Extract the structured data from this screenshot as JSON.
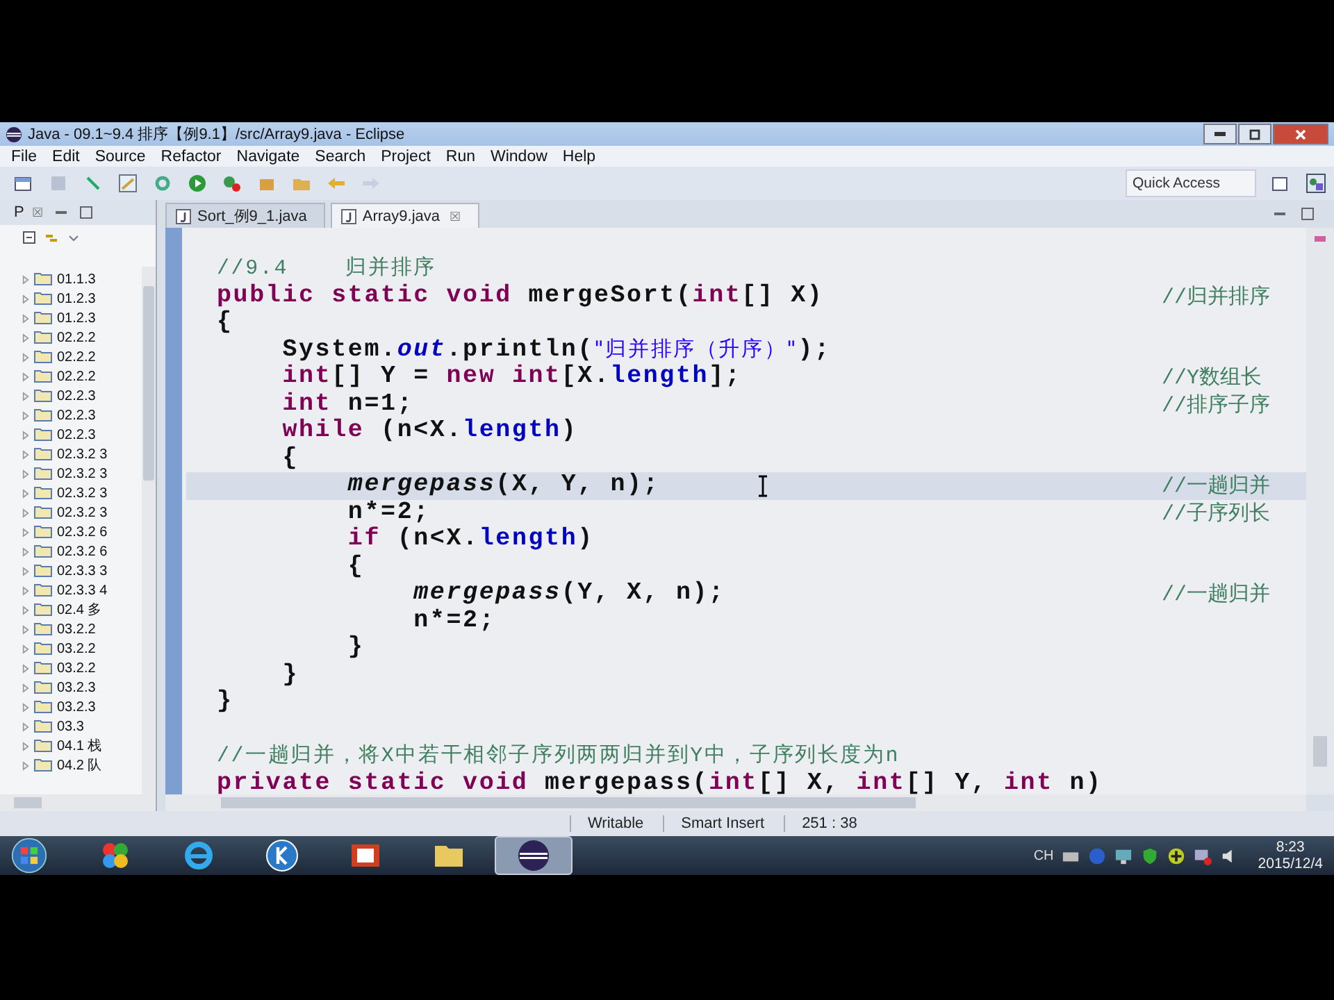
{
  "window": {
    "title": "Java - 09.1~9.4 排序【例9.1】/src/Array9.java - Eclipse"
  },
  "menu": [
    "File",
    "Edit",
    "Source",
    "Refactor",
    "Navigate",
    "Search",
    "Project",
    "Run",
    "Window",
    "Help"
  ],
  "quick_access": {
    "placeholder": "Quick Access"
  },
  "sidebar": {
    "tab": {
      "label": "P",
      "close": "☒"
    },
    "items": [
      {
        "label": "01.1.3"
      },
      {
        "label": "01.2.3"
      },
      {
        "label": "01.2.3"
      },
      {
        "label": "02.2.2"
      },
      {
        "label": "02.2.2"
      },
      {
        "label": "02.2.2"
      },
      {
        "label": "02.2.3"
      },
      {
        "label": "02.2.3"
      },
      {
        "label": "02.2.3"
      },
      {
        "label": "02.3.2 3"
      },
      {
        "label": "02.3.2 3"
      },
      {
        "label": "02.3.2 3"
      },
      {
        "label": "02.3.2 3"
      },
      {
        "label": "02.3.2 6"
      },
      {
        "label": "02.3.2 6"
      },
      {
        "label": "02.3.3 3"
      },
      {
        "label": "02.3.3 4"
      },
      {
        "label": "02.4 多"
      },
      {
        "label": "03.2.2"
      },
      {
        "label": "03.2.2"
      },
      {
        "label": "03.2.2"
      },
      {
        "label": "03.2.3"
      },
      {
        "label": "03.2.3"
      },
      {
        "label": "03.3"
      },
      {
        "label": "04.1 栈"
      },
      {
        "label": "04.2 队"
      }
    ]
  },
  "editor_tabs": [
    {
      "label": "Sort_例9_1.java",
      "selected": false
    },
    {
      "label": "Array9.java",
      "selected": true,
      "close": "☒"
    }
  ],
  "code": [
    {
      "current": false,
      "code": [
        {
          "text": "//9.4    归并排序",
          "kind": "comment"
        }
      ]
    },
    {
      "current": false,
      "code": [
        {
          "text": "public static void",
          "kind": "keyword"
        },
        {
          "text": " mergeSort(",
          "kind": "plain"
        },
        {
          "text": "int",
          "kind": "keyword"
        },
        {
          "text": "[] X)",
          "kind": "plain"
        }
      ],
      "comment": "//归并排序"
    },
    {
      "current": false,
      "code": [
        {
          "text": "{",
          "kind": "plain"
        }
      ]
    },
    {
      "current": false,
      "code": [
        {
          "text": "    System.",
          "kind": "plain"
        },
        {
          "text": "out",
          "kind": "field"
        },
        {
          "text": ".println(",
          "kind": "plain"
        },
        {
          "text": "\"归并排序（升序）\"",
          "kind": "string"
        },
        {
          "text": ");",
          "kind": "plain"
        }
      ]
    },
    {
      "current": false,
      "code": [
        {
          "text": "    int",
          "kind": "keyword"
        },
        {
          "text": "[] Y = ",
          "kind": "plain"
        },
        {
          "text": "new int",
          "kind": "keyword"
        },
        {
          "text": "[X.",
          "kind": "plain"
        },
        {
          "text": "length",
          "kind": "member"
        },
        {
          "text": "];",
          "kind": "plain"
        }
      ],
      "comment": "//Y数组长"
    },
    {
      "current": false,
      "code": [
        {
          "text": "    int",
          "kind": "keyword"
        },
        {
          "text": " n=1;",
          "kind": "plain"
        }
      ],
      "comment": "//排序子序"
    },
    {
      "current": false,
      "code": [
        {
          "text": "    while",
          "kind": "keyword"
        },
        {
          "text": " (n<X.",
          "kind": "plain"
        },
        {
          "text": "length",
          "kind": "member"
        },
        {
          "text": ")",
          "kind": "plain"
        }
      ]
    },
    {
      "current": false,
      "code": [
        {
          "text": "    {",
          "kind": "plain"
        }
      ]
    },
    {
      "current": true,
      "code": [
        {
          "text": "        mergepass",
          "kind": "call"
        },
        {
          "text": "(X, Y, n);",
          "kind": "plain"
        }
      ],
      "comment": "//一趟归并"
    },
    {
      "current": false,
      "code": [
        {
          "text": "        n*=2;",
          "kind": "plain"
        }
      ],
      "comment": "//子序列长"
    },
    {
      "current": false,
      "code": [
        {
          "text": "        if",
          "kind": "keyword"
        },
        {
          "text": " (n<X.",
          "kind": "plain"
        },
        {
          "text": "length",
          "kind": "member"
        },
        {
          "text": ")",
          "kind": "plain"
        }
      ]
    },
    {
      "current": false,
      "code": [
        {
          "text": "        {",
          "kind": "plain"
        }
      ]
    },
    {
      "current": false,
      "code": [
        {
          "text": "            mergepass",
          "kind": "call"
        },
        {
          "text": "(Y, X, n);",
          "kind": "plain"
        }
      ],
      "comment": "//一趟归并"
    },
    {
      "current": false,
      "code": [
        {
          "text": "            n*=2;",
          "kind": "plain"
        }
      ]
    },
    {
      "current": false,
      "code": [
        {
          "text": "        }",
          "kind": "plain"
        }
      ]
    },
    {
      "current": false,
      "code": [
        {
          "text": "    }",
          "kind": "plain"
        }
      ]
    },
    {
      "current": false,
      "code": [
        {
          "text": "}",
          "kind": "plain"
        }
      ]
    },
    {
      "current": false,
      "blank_line_before": true,
      "code": [
        {
          "text": "//一趟归并，将X中若干相邻子序列两两归并到Y中，子序列长度为n",
          "kind": "comment"
        }
      ]
    },
    {
      "current": false,
      "code": [
        {
          "text": "private static void",
          "kind": "keyword"
        },
        {
          "text": " mergepass(",
          "kind": "plain"
        },
        {
          "text": "int",
          "kind": "keyword"
        },
        {
          "text": "[] X, ",
          "kind": "plain"
        },
        {
          "text": "int",
          "kind": "keyword"
        },
        {
          "text": "[] Y, ",
          "kind": "plain"
        },
        {
          "text": "int",
          "kind": "keyword"
        },
        {
          "text": " n)",
          "kind": "plain"
        }
      ]
    }
  ],
  "status_bar": [
    "Writable",
    "Smart Insert",
    "251 : 38"
  ],
  "taskbar": {
    "apps": [
      {
        "kind": "colors",
        "selected": false
      },
      {
        "kind": "ie",
        "selected": false
      },
      {
        "kind": "k",
        "selected": false
      },
      {
        "kind": "slides",
        "selected": false
      },
      {
        "kind": "folder",
        "selected": false
      },
      {
        "kind": "eclipse",
        "selected": true
      }
    ],
    "language": "CH",
    "time": "8:23",
    "date": "2015/12/4"
  }
}
